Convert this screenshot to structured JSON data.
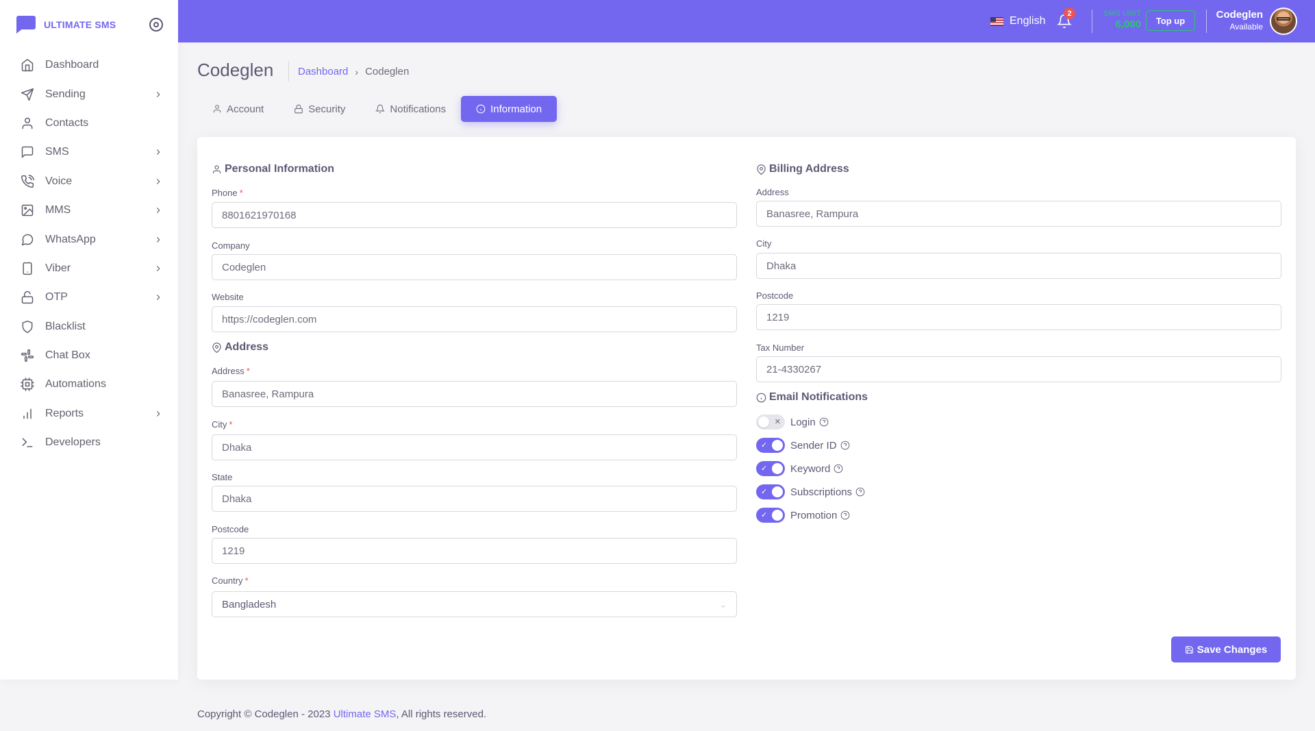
{
  "brand": {
    "name": "ULTIMATE SMS"
  },
  "sidebar": {
    "items": [
      {
        "label": "Dashboard",
        "icon": "home-icon",
        "has_children": false
      },
      {
        "label": "Sending",
        "icon": "send-icon",
        "has_children": true
      },
      {
        "label": "Contacts",
        "icon": "user-icon",
        "has_children": false
      },
      {
        "label": "SMS",
        "icon": "message-square-icon",
        "has_children": true
      },
      {
        "label": "Voice",
        "icon": "phone-call-icon",
        "has_children": true
      },
      {
        "label": "MMS",
        "icon": "image-icon",
        "has_children": true
      },
      {
        "label": "WhatsApp",
        "icon": "message-circle-icon",
        "has_children": true
      },
      {
        "label": "Viber",
        "icon": "smartphone-icon",
        "has_children": true
      },
      {
        "label": "OTP",
        "icon": "unlock-icon",
        "has_children": true
      },
      {
        "label": "Blacklist",
        "icon": "shield-icon",
        "has_children": false
      },
      {
        "label": "Chat Box",
        "icon": "slack-icon",
        "has_children": false
      },
      {
        "label": "Automations",
        "icon": "cpu-icon",
        "has_children": false
      },
      {
        "label": "Reports",
        "icon": "bar-chart-icon",
        "has_children": true
      },
      {
        "label": "Developers",
        "icon": "terminal-icon",
        "has_children": false
      }
    ]
  },
  "topbar": {
    "language": "English",
    "notifications_count": "2",
    "sms_unit_label": "SMS UNIT",
    "sms_unit_value": "6,000",
    "topup_label": "Top up",
    "user_name": "Codeglen",
    "user_status": "Available"
  },
  "header": {
    "title": "Codeglen",
    "breadcrumb_home": "Dashboard",
    "breadcrumb_current": "Codeglen"
  },
  "tabs": [
    {
      "label": "Account",
      "active": false
    },
    {
      "label": "Security",
      "active": false
    },
    {
      "label": "Notifications",
      "active": false
    },
    {
      "label": "Information",
      "active": true
    }
  ],
  "personal": {
    "title": "Personal Information",
    "phone_label": "Phone",
    "phone_value": "8801621970168",
    "company_label": "Company",
    "company_value": "Codeglen",
    "website_label": "Website",
    "website_value": "https://codeglen.com"
  },
  "address": {
    "title": "Address",
    "address_label": "Address",
    "address_value": "Banasree, Rampura",
    "city_label": "City",
    "city_value": "Dhaka",
    "state_label": "State",
    "state_value": "Dhaka",
    "postcode_label": "Postcode",
    "postcode_value": "1219",
    "country_label": "Country",
    "country_value": "Bangladesh"
  },
  "billing": {
    "title": "Billing Address",
    "address_label": "Address",
    "address_value": "Banasree, Rampura",
    "city_label": "City",
    "city_value": "Dhaka",
    "postcode_label": "Postcode",
    "postcode_value": "1219",
    "tax_label": "Tax Number",
    "tax_value": "21-4330267"
  },
  "email_notifications": {
    "title": "Email Notifications",
    "items": [
      {
        "label": "Login",
        "enabled": false
      },
      {
        "label": "Sender ID",
        "enabled": true
      },
      {
        "label": "Keyword",
        "enabled": true
      },
      {
        "label": "Subscriptions",
        "enabled": true
      },
      {
        "label": "Promotion",
        "enabled": true
      }
    ]
  },
  "actions": {
    "save_label": "Save Changes"
  },
  "footer": {
    "prefix": "Copyright © Codeglen - 2023",
    "link": "Ultimate SMS",
    "suffix": ", All rights reserved."
  },
  "colors": {
    "primary": "#7367f0",
    "success": "#28c76f",
    "danger": "#ea5455"
  }
}
